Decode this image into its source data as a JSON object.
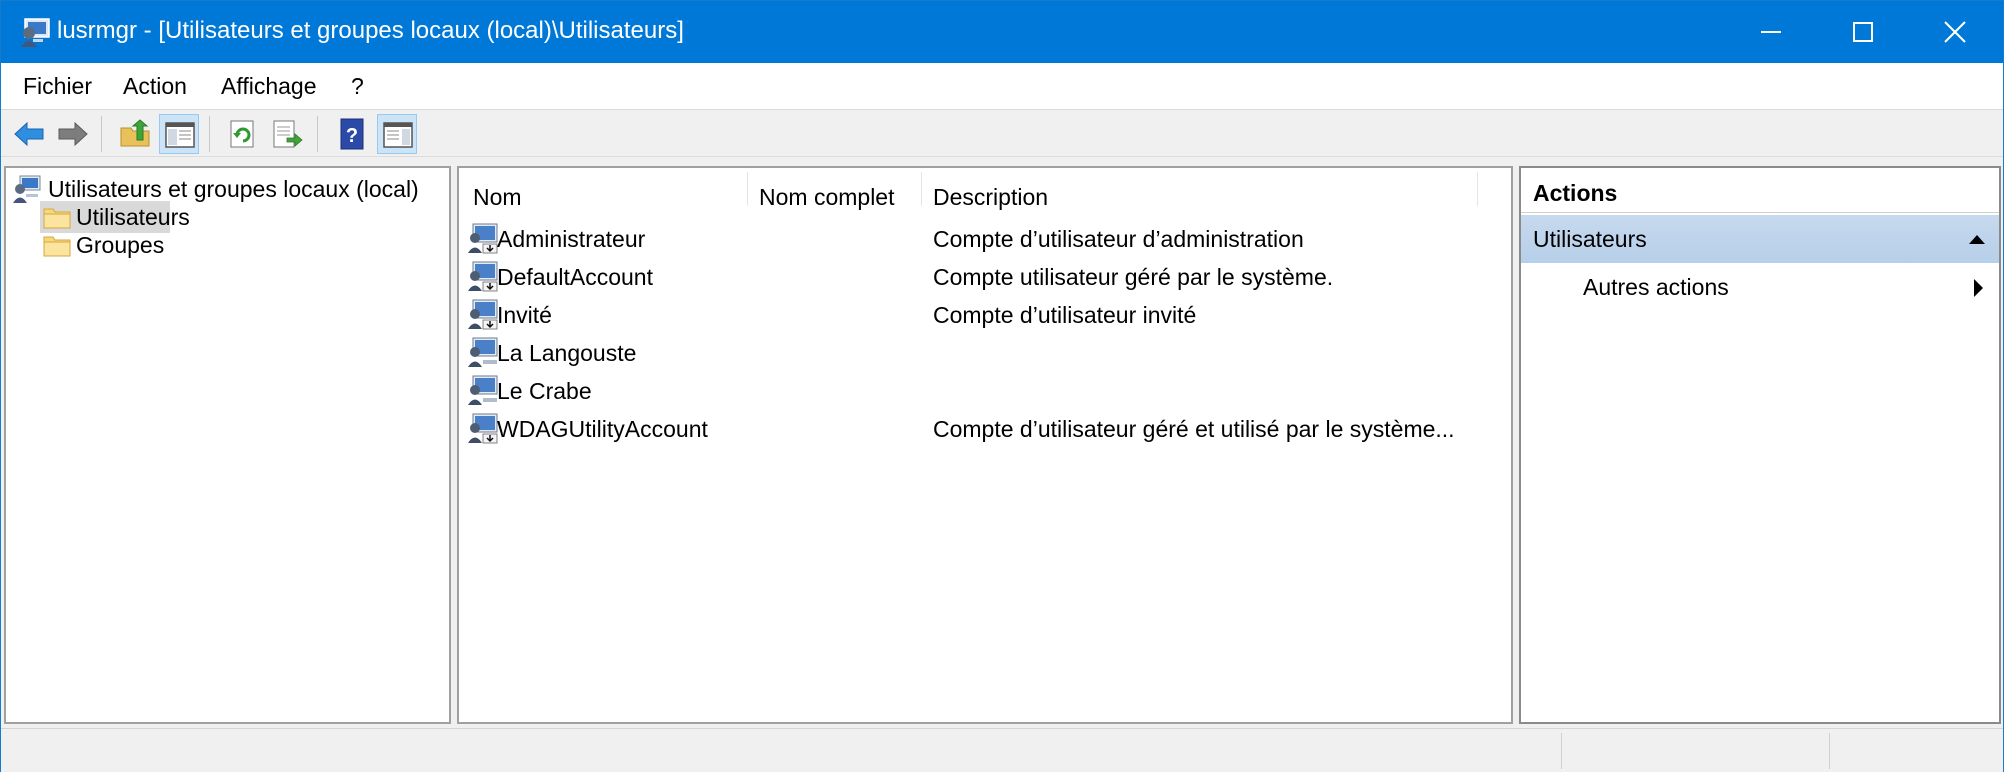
{
  "window": {
    "title": "lusrmgr - [Utilisateurs et groupes locaux (local)\\Utilisateurs]",
    "accent_color": "#0078d7"
  },
  "menu": {
    "items": [
      "Fichier",
      "Action",
      "Affichage",
      "?"
    ]
  },
  "toolbar": {
    "buttons": [
      "back-arrow-icon",
      "forward-arrow-icon",
      "up-folder-icon",
      "show-hide-tree-icon",
      "refresh-icon",
      "export-list-icon",
      "help-icon",
      "show-hide-action-pane-icon"
    ]
  },
  "tree": {
    "root": "Utilisateurs et groupes locaux (local)",
    "children": [
      "Utilisateurs",
      "Groupes"
    ],
    "selected": "Utilisateurs"
  },
  "list": {
    "columns": [
      "Nom",
      "Nom complet",
      "Description"
    ],
    "rows": [
      {
        "name": "Administrateur",
        "full_name": "",
        "description": "Compte d’utilisateur d’administration"
      },
      {
        "name": "DefaultAccount",
        "full_name": "",
        "description": "Compte utilisateur géré par le système."
      },
      {
        "name": "Invité",
        "full_name": "",
        "description": "Compte d’utilisateur invité"
      },
      {
        "name": "La Langouste",
        "full_name": "",
        "description": ""
      },
      {
        "name": "Le Crabe",
        "full_name": "",
        "description": ""
      },
      {
        "name": "WDAGUtilityAccount",
        "full_name": "",
        "description": "Compte d’utilisateur géré et utilisé par le système..."
      }
    ]
  },
  "actions": {
    "title": "Actions",
    "section": "Utilisateurs",
    "items": [
      "Autres actions"
    ]
  }
}
